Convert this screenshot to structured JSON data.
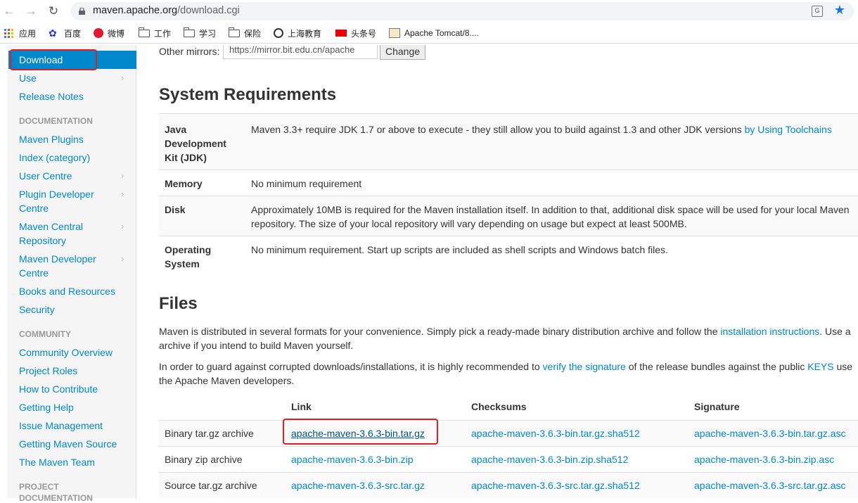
{
  "browser": {
    "url_host": "maven.apache.org",
    "url_path": "/download.cgi",
    "bookmarks": [
      "应用",
      "百度",
      "微博",
      "工作",
      "学习",
      "保险",
      "上海教育",
      "头条号",
      "Apache Tomcat/8...."
    ]
  },
  "sidebar": {
    "active": "Download",
    "items_top": [
      {
        "label": "Use",
        "chevron": true
      },
      {
        "label": "Release Notes",
        "chevron": false
      }
    ],
    "documentation_heading": "DOCUMENTATION",
    "documentation_items": [
      {
        "label": "Maven Plugins",
        "chevron": false
      },
      {
        "label": "Index (category)",
        "chevron": false
      },
      {
        "label": "User Centre",
        "chevron": true
      },
      {
        "label": "Plugin Developer",
        "label2": "Centre",
        "chevron": true
      },
      {
        "label": "Maven Central",
        "label2": "Repository",
        "chevron": true
      },
      {
        "label": "Maven Developer",
        "label2": "Centre",
        "chevron": true
      },
      {
        "label": "Books and Resources",
        "chevron": false
      },
      {
        "label": "Security",
        "chevron": false
      }
    ],
    "community_heading": "COMMUNITY",
    "community_items": [
      "Community Overview",
      "Project Roles",
      "How to Contribute",
      "Getting Help",
      "Issue Management",
      "Getting Maven Source",
      "The Maven Team"
    ],
    "project_heading": "PROJECT",
    "project_heading2": "DOCUMENTATION"
  },
  "mirrors": {
    "label": "Other mirrors:",
    "value": "https://mirror.bit.edu.cn/apache",
    "button": "Change"
  },
  "system_requirements": {
    "title": "System Requirements",
    "rows": [
      {
        "key_lines": [
          "Java",
          "Development",
          "Kit (JDK)"
        ],
        "value": "Maven 3.3+ require JDK 1.7 or above to execute - they still allow you to build against 1.3 and other JDK versions ",
        "link": "by Using Toolchains"
      },
      {
        "key_lines": [
          "Memory"
        ],
        "value": "No minimum requirement"
      },
      {
        "key_lines": [
          "Disk"
        ],
        "value": "Approximately 10MB is required for the Maven installation itself. In addition to that, additional disk space will be used for your local Maven",
        "value2": "repository. The size of your local repository will vary depending on usage but expect at least 500MB."
      },
      {
        "key_lines": [
          "Operating",
          "System"
        ],
        "value": "No minimum requirement. Start up scripts are included as shell scripts and Windows batch files."
      }
    ]
  },
  "files": {
    "title": "Files",
    "para1_a": "Maven is distributed in several formats for your convenience. Simply pick a ready-made binary distribution archive and follow the ",
    "para1_link": "installation instructions",
    "para1_b": ". Use a",
    "para1_line2": "archive if you intend to build Maven yourself.",
    "para2_a": "In order to guard against corrupted downloads/installations, it is highly recommended to ",
    "para2_link1": "verify the signature",
    "para2_b": " of the release bundles against the public ",
    "para2_link2": "KEYS",
    "para2_c": " use",
    "para2_line2": "the Apache Maven developers.",
    "headers": {
      "link": "Link",
      "checksums": "Checksums",
      "signature": "Signature"
    },
    "rows": [
      {
        "label": "Binary tar.gz archive",
        "link": "apache-maven-3.6.3-bin.tar.gz",
        "checksum": "apache-maven-3.6.3-bin.tar.gz.sha512",
        "signature": "apache-maven-3.6.3-bin.tar.gz.asc"
      },
      {
        "label": "Binary zip archive",
        "link": "apache-maven-3.6.3-bin.zip",
        "checksum": "apache-maven-3.6.3-bin.zip.sha512",
        "signature": "apache-maven-3.6.3-bin.zip.asc"
      },
      {
        "label": "Source tar.gz archive",
        "link": "apache-maven-3.6.3-src.tar.gz",
        "checksum": "apache-maven-3.6.3-src.tar.gz.sha512",
        "signature": "apache-maven-3.6.3-src.tar.gz.asc"
      }
    ]
  }
}
